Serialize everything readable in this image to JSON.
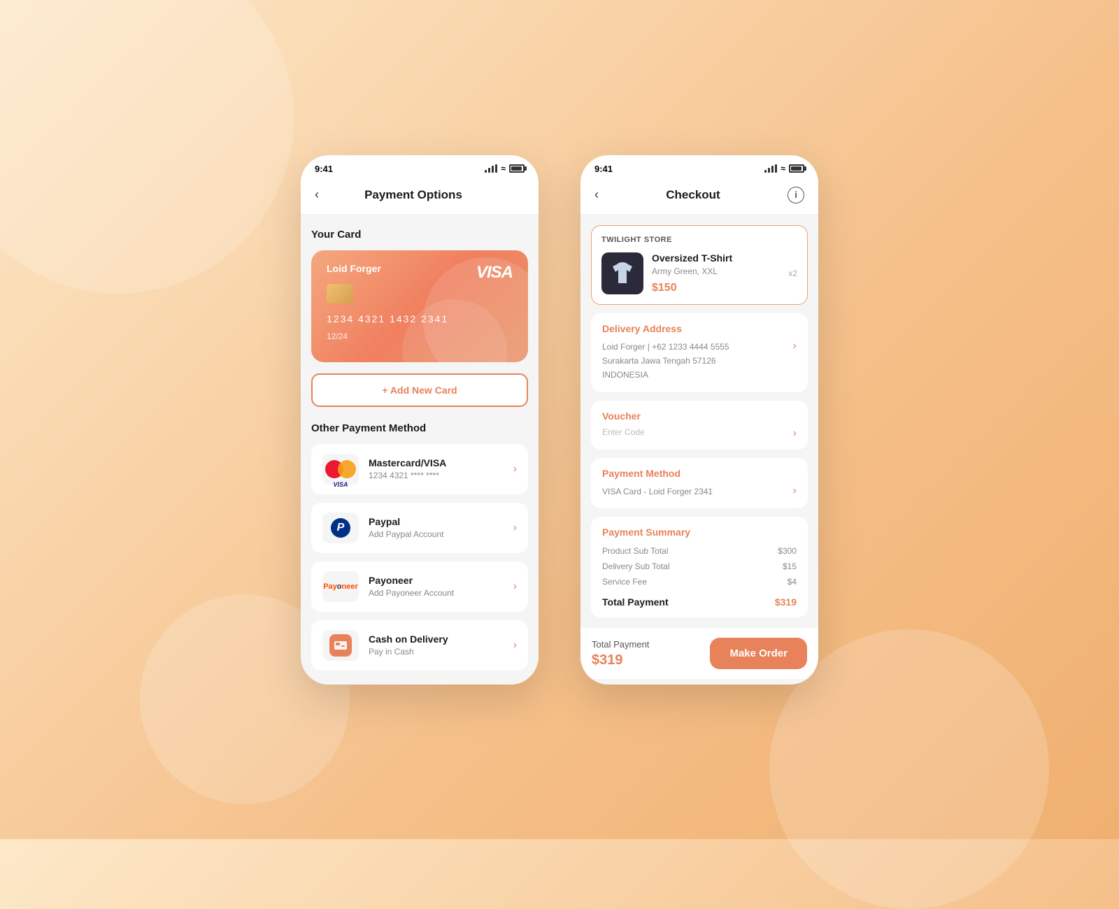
{
  "background": {
    "color": "#f5b878"
  },
  "phone_left": {
    "status_bar": {
      "time": "9:41"
    },
    "header": {
      "back_label": "‹",
      "title": "Payment Options",
      "right": ""
    },
    "your_card_section": {
      "label": "Your Card",
      "card": {
        "name": "Loid Forger",
        "network": "VISA",
        "number": "1234   4321   1432   2341",
        "expiry": "12/24"
      },
      "add_card_label": "+ Add New Card"
    },
    "other_methods_section": {
      "label": "Other Payment Method",
      "items": [
        {
          "name": "Mastercard/VISA",
          "sub": "1234  4321  ****  ****",
          "icon": "mastercard-visa"
        },
        {
          "name": "Paypal",
          "sub": "Add Paypal Account",
          "icon": "paypal"
        },
        {
          "name": "Payoneer",
          "sub": "Add Payoneer Account",
          "icon": "payoneer"
        },
        {
          "name": "Cash on Delivery",
          "sub": "Pay in Cash",
          "icon": "cash"
        }
      ]
    }
  },
  "phone_right": {
    "status_bar": {
      "time": "9:41"
    },
    "header": {
      "back_label": "‹",
      "title": "Checkout"
    },
    "store": {
      "name": "TWILIGHT STORE",
      "product": {
        "name": "Oversized T-Shirt",
        "variant": "Army Green, XXL",
        "price": "$150",
        "qty": "x2"
      }
    },
    "delivery_address": {
      "section_title": "Delivery Address",
      "line1": "Loid Forger | +62 1233 4444 5555",
      "line2": "Surakarta Jawa Tengah 57126",
      "line3": "INDONESIA"
    },
    "voucher": {
      "section_title": "Voucher",
      "placeholder": "Enter Code"
    },
    "payment_method": {
      "section_title": "Payment Method",
      "value": "VISA Card - Loid Forger 2341"
    },
    "payment_summary": {
      "title": "Payment Summary",
      "rows": [
        {
          "label": "Product Sub Total",
          "value": "$300"
        },
        {
          "label": "Delivery Sub Total",
          "value": "$15"
        },
        {
          "label": "Service Fee",
          "value": "$4"
        }
      ],
      "total_label": "Total Payment",
      "total_value": "$319"
    },
    "bottom_bar": {
      "total_label": "Total Payment",
      "total_value": "$319",
      "button_label": "Make Order"
    }
  }
}
